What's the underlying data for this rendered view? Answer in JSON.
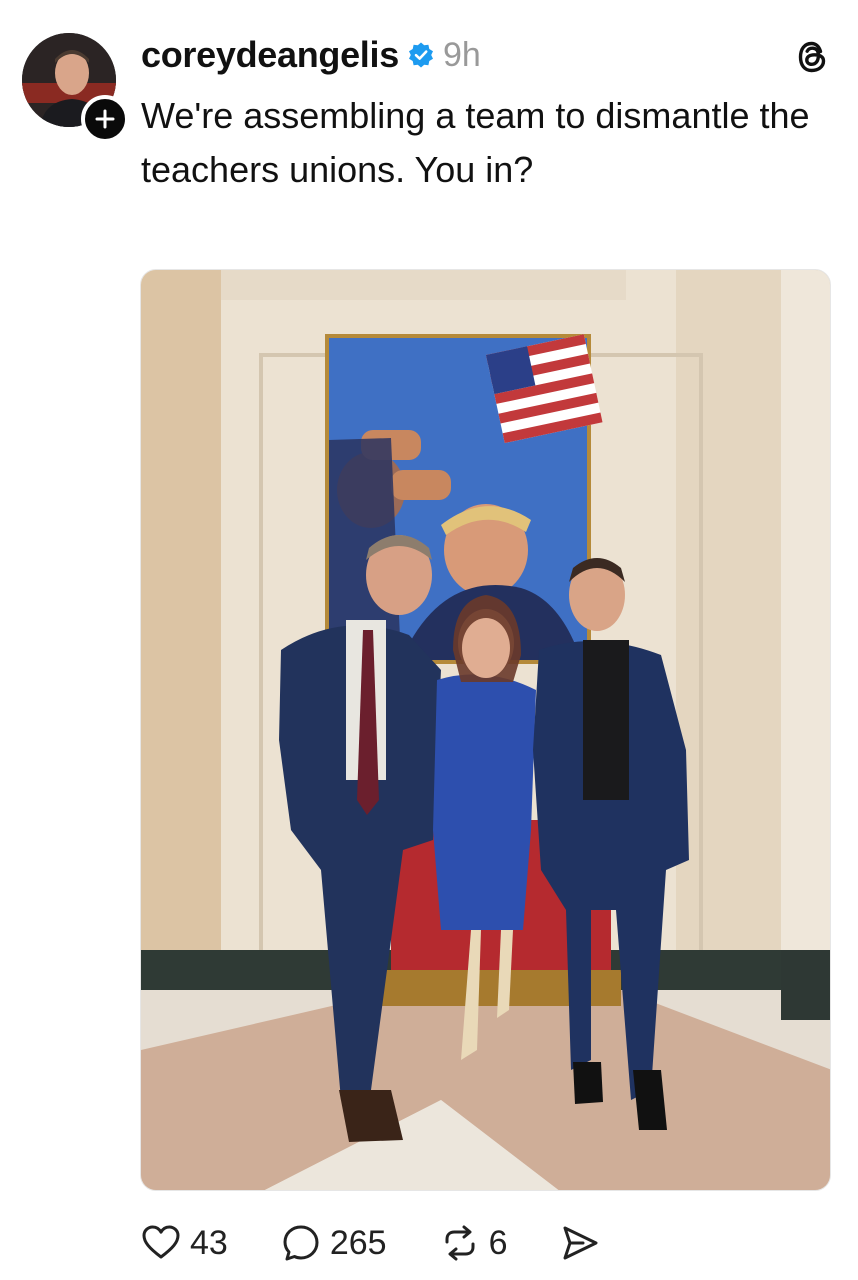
{
  "post": {
    "username": "coreydeangelis",
    "verified": true,
    "timestamp": "9h",
    "text": "We're assembling a team to dismantle the teachers unions. You in?",
    "photo": {
      "icons": [
        "american-flag",
        "painting",
        "three-people-standing"
      ]
    }
  },
  "actions": {
    "like_count": "43",
    "reply_count": "265",
    "repost_count": "6"
  },
  "colors": {
    "verified": "#1d9bf0",
    "muted_text": "#999999",
    "text": "#111111"
  }
}
